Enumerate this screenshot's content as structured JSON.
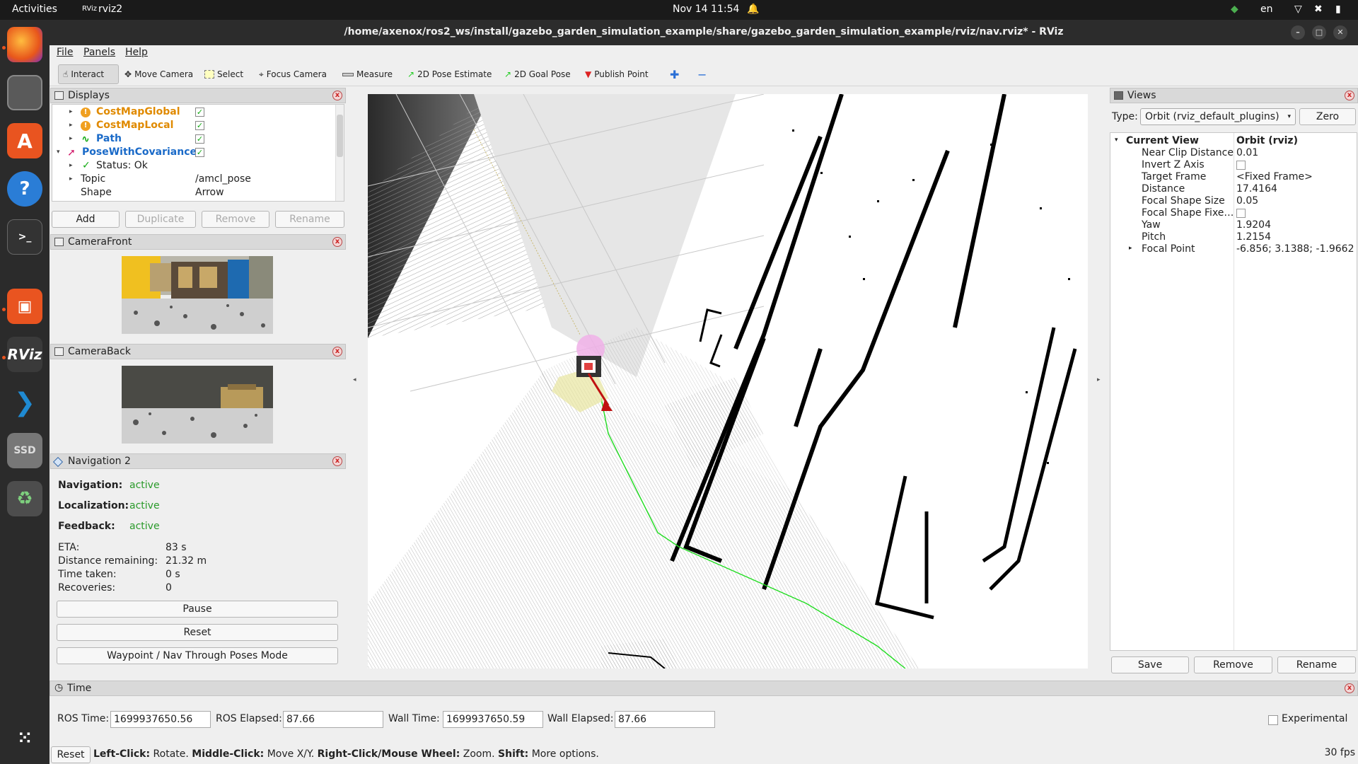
{
  "topbar": {
    "activities": "Activities",
    "app_label": "rviz2",
    "app_prefix": "RViz",
    "datetime": "Nov 14  11:54",
    "lang": "en"
  },
  "window": {
    "title": "/home/axenox/ros2_ws/install/gazebo_garden_simulation_example/share/gazebo_garden_simulation_example/rviz/nav.rviz* - RViz"
  },
  "menu": {
    "file": "File",
    "panels": "Panels",
    "help": "Help"
  },
  "toolbar": {
    "interact": "Interact",
    "move_camera": "Move Camera",
    "select": "Select",
    "focus_camera": "Focus Camera",
    "measure": "Measure",
    "pose_estimate": "2D Pose Estimate",
    "goal_pose": "2D Goal Pose",
    "publish_point": "Publish Point"
  },
  "displays": {
    "title": "Displays",
    "items": [
      {
        "label": "CostMapGlobal",
        "checked": true
      },
      {
        "label": "CostMapLocal",
        "checked": true
      },
      {
        "label": "Path",
        "checked": true
      },
      {
        "label": "PoseWithCovariance",
        "checked": true
      }
    ],
    "status": "Status: Ok",
    "topic_label": "Topic",
    "topic_value": "/amcl_pose",
    "shape_label": "Shape",
    "shape_value": "Arrow",
    "buttons": {
      "add": "Add",
      "duplicate": "Duplicate",
      "remove": "Remove",
      "rename": "Rename"
    }
  },
  "camera_front": {
    "title": "CameraFront"
  },
  "camera_back": {
    "title": "CameraBack"
  },
  "navigation": {
    "title": "Navigation 2",
    "navigation_label": "Navigation:",
    "navigation_value": "active",
    "localization_label": "Localization:",
    "localization_value": "active",
    "feedback_label": "Feedback:",
    "feedback_value": "active",
    "eta_label": "ETA:",
    "eta_value": "83 s",
    "distance_label": "Distance remaining:",
    "distance_value": "21.32 m",
    "time_label": "Time taken:",
    "time_value": "0 s",
    "recoveries_label": "Recoveries:",
    "recoveries_value": "0",
    "pause": "Pause",
    "reset": "Reset",
    "waypoint_mode": "Waypoint / Nav Through Poses Mode"
  },
  "views": {
    "title": "Views",
    "type_label": "Type:",
    "type_value": "Orbit (rviz_default_plugins)",
    "zero": "Zero",
    "current_view_label": "Current View",
    "current_view_value": "Orbit (rviz)",
    "props": [
      {
        "name": "Near Clip Distance",
        "value": "0.01"
      },
      {
        "name": "Invert Z Axis",
        "value": ""
      },
      {
        "name": "Target Frame",
        "value": "<Fixed Frame>"
      },
      {
        "name": "Distance",
        "value": "17.4164"
      },
      {
        "name": "Focal Shape Size",
        "value": "0.05"
      },
      {
        "name": "Focal Shape Fixe…",
        "value": ""
      },
      {
        "name": "Yaw",
        "value": "1.9204"
      },
      {
        "name": "Pitch",
        "value": "1.2154"
      },
      {
        "name": "Focal Point",
        "value": "-6.856; 3.1388; -1.9662"
      }
    ],
    "save": "Save",
    "remove": "Remove",
    "rename": "Rename"
  },
  "time": {
    "title": "Time",
    "ros_time_label": "ROS Time:",
    "ros_time": "1699937650.56",
    "ros_elapsed_label": "ROS Elapsed:",
    "ros_elapsed": "87.66",
    "wall_time_label": "Wall Time:",
    "wall_time": "1699937650.59",
    "wall_elapsed_label": "Wall Elapsed:",
    "wall_elapsed": "87.66",
    "experimental": "Experimental"
  },
  "status": {
    "reset": "Reset",
    "hint_lc": "Left-Click:",
    "hint_lc_t": " Rotate. ",
    "hint_mc": "Middle-Click:",
    "hint_mc_t": " Move X/Y. ",
    "hint_rc": "Right-Click/Mouse Wheel:",
    "hint_rc_t": " Zoom. ",
    "hint_sh": "Shift:",
    "hint_sh_t": " More options.",
    "fps": "30 fps"
  },
  "dock": {
    "ssd": "SSD",
    "rviz": "RViz"
  }
}
